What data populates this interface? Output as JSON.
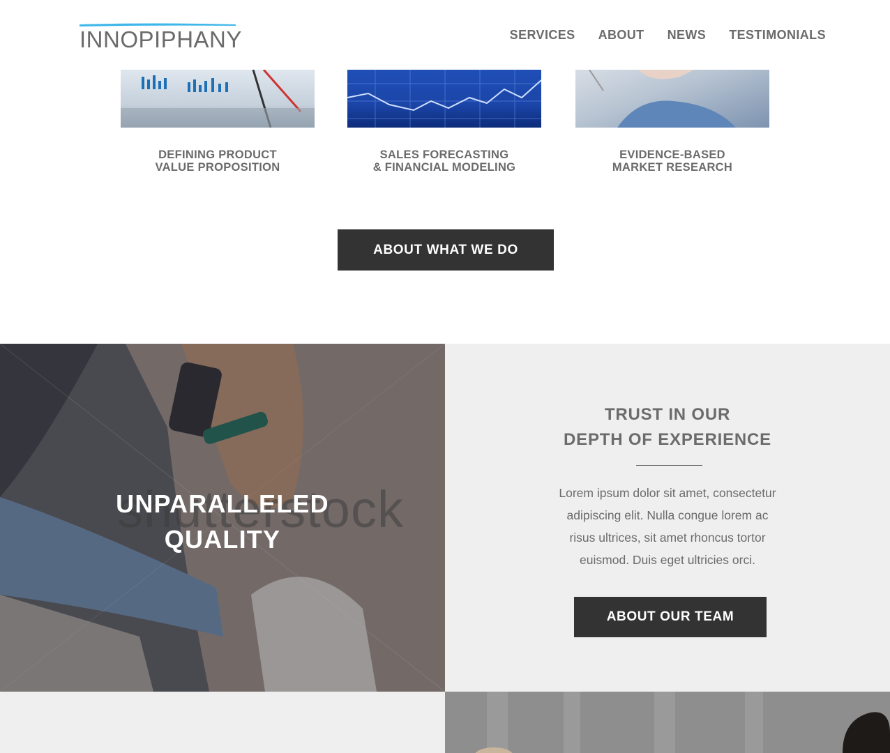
{
  "header": {
    "logo_text": "INNOPIPHANY",
    "nav": [
      "SERVICES",
      "ABOUT",
      "NEWS",
      "TESTIMONIALS"
    ]
  },
  "services": [
    {
      "title_line1": "DEFINING PRODUCT",
      "title_line2": "VALUE PROPOSITION",
      "icon": "charts-paperwork-photo"
    },
    {
      "title_line1": "SALES FORECASTING",
      "title_line2": "& FINANCIAL MODELING",
      "icon": "forecast-graph-photo"
    },
    {
      "title_line1": "EVIDENCE-BASED",
      "title_line2": "MARKET RESEARCH",
      "icon": "hands-research-photo"
    }
  ],
  "about_button": "ABOUT WHAT WE DO",
  "quality": {
    "title_line1": "UNPARALLELED",
    "title_line2": "QUALITY",
    "watermark": "shutterstock"
  },
  "trust": {
    "title_line1": "TRUST IN OUR",
    "title_line2": "DEPTH OF EXPERIENCE",
    "body": "Lorem ipsum dolor sit amet, consectetur adipiscing elit. Nulla congue lorem ac risus ultrices, sit amet rhoncus tortor euismod. Duis eget ultricies orci.",
    "button": "ABOUT OUR TEAM"
  },
  "colors": {
    "accent": "#3fb7ea",
    "button_bg": "#333333",
    "text_gray": "#6b6b6b",
    "panel_bg": "#efefef"
  }
}
